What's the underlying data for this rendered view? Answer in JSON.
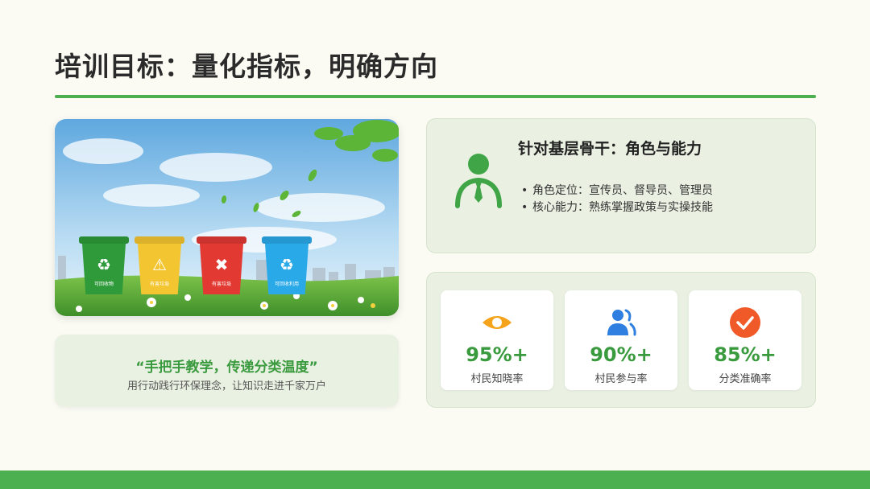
{
  "title": "培训目标：量化指标，明确方向",
  "hero": {
    "bins": [
      {
        "label": "可回收物",
        "color": "#2e9a3a"
      },
      {
        "label": "有害垃圾",
        "color": "#f3c531"
      },
      {
        "label": "有害垃圾",
        "color": "#e23a33"
      },
      {
        "label": "可回收利用",
        "color": "#2aa9e8"
      }
    ]
  },
  "quote": {
    "main": "“手把手教学，传递分类温度”",
    "sub": "用行动践行环保理念，让知识走进千家万户"
  },
  "role": {
    "title": "针对基层骨干：角色与能力",
    "icon": "person-tie-icon",
    "items": [
      {
        "bullet": "•",
        "text": "角色定位：宣传员、督导员、管理员"
      },
      {
        "bullet": "•",
        "text": "核心能力：熟练掌握政策与实操技能"
      }
    ]
  },
  "stats": [
    {
      "icon": "eye-icon",
      "value": "95%+",
      "label": "村民知晓率",
      "color": "#f5a31a"
    },
    {
      "icon": "users-icon",
      "value": "90%+",
      "label": "村民参与率",
      "color": "#2f7fe0"
    },
    {
      "icon": "check-circle-icon",
      "value": "85%+",
      "label": "分类准确率",
      "color": "#f05a28"
    }
  ],
  "colors": {
    "accent": "#4caf50",
    "text_green": "#3a9a3e"
  }
}
